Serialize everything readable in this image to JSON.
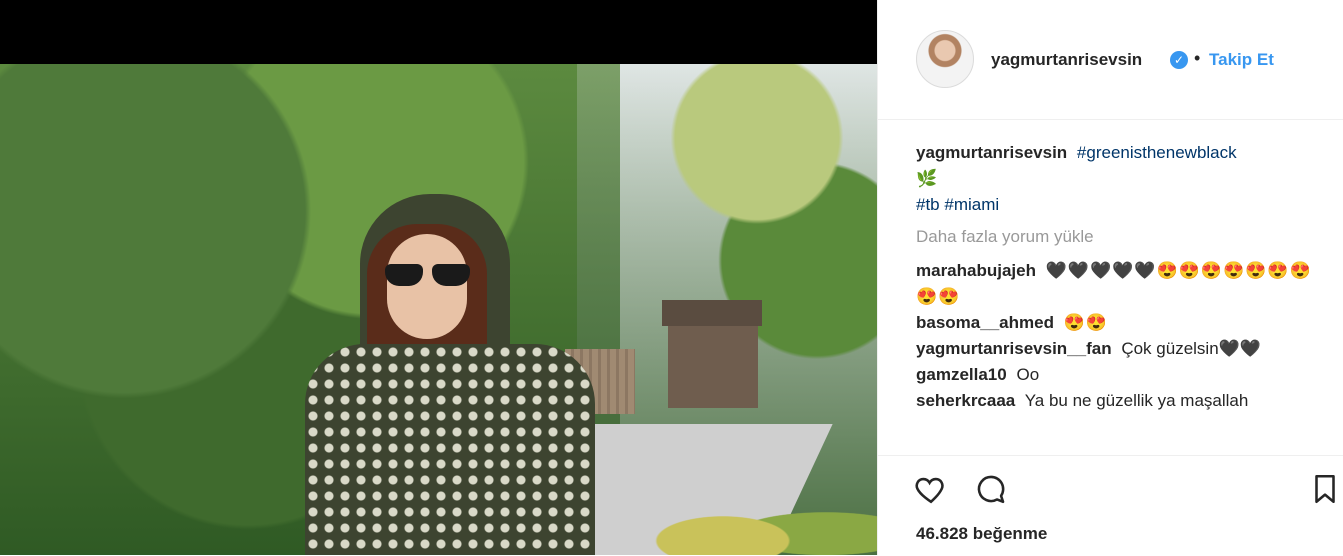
{
  "header": {
    "username": "yagmurtanrisevsin",
    "separator": "•",
    "follow_label": "Takip Et"
  },
  "caption": {
    "username": "yagmurtanrisevsin",
    "hashtag1": "#greenisthenewblack",
    "emoji": "🌿",
    "hashtag2": "#tb",
    "hashtag3": "#miami"
  },
  "load_more": "Daha fazla yorum yükle",
  "comments": [
    {
      "user": "marahabujajeh",
      "text": "🖤🖤🖤🖤🖤😍😍😍😍😍😍😍😍😍"
    },
    {
      "user": "basoma__ahmed",
      "text": "😍😍"
    },
    {
      "user": "yagmurtanrisevsin__fan",
      "text": "Çok güzelsin🖤🖤"
    },
    {
      "user": "gamzella10",
      "text": "Oo"
    },
    {
      "user": "seherkrcaaa",
      "text": "Ya bu ne güzellik ya maşallah"
    }
  ],
  "likes": "46.828 beğenme",
  "icons": {
    "like": "heart-icon",
    "comment": "comment-icon",
    "save": "bookmark-icon",
    "verified": "verified-badge-icon"
  },
  "colors": {
    "link": "#3897f0",
    "hashtag": "#003569",
    "muted": "#999999"
  }
}
